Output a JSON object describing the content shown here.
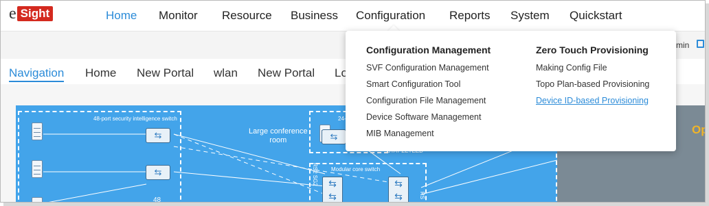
{
  "logo": {
    "prefix": "e",
    "boxed": "Sight"
  },
  "nav": {
    "items": [
      {
        "label": "Home",
        "active": true
      },
      {
        "label": "Monitor"
      },
      {
        "label": "Resource"
      },
      {
        "label": "Business"
      },
      {
        "label": "Configuration"
      },
      {
        "label": "Reports"
      },
      {
        "label": "System"
      },
      {
        "label": "Quickstart"
      }
    ]
  },
  "user": {
    "text": "min"
  },
  "tabs": {
    "items": [
      {
        "label": "Navigation",
        "active": true
      },
      {
        "label": "Home"
      },
      {
        "label": "New Portal"
      },
      {
        "label": "wlan"
      },
      {
        "label": "New Portal"
      },
      {
        "label": "Lo"
      }
    ]
  },
  "dropdown": {
    "col1": {
      "title": "Configuration Management",
      "items": [
        "SVF Configuration Management",
        "Smart Configuration Tool",
        "Configuration File Management",
        "Device Software Management",
        "MIB Management"
      ]
    },
    "col2": {
      "title": "Zero Touch Provisioning",
      "items": [
        "Making Config File",
        "Topo Plan-based Provisioning",
        "Device ID-based Provisioning"
      ]
    }
  },
  "topology": {
    "zone1_label": "48-port security intelligence switch",
    "zone2_label": "24-",
    "zone3_label": "Modular core switch",
    "conference_line1": "Large conference",
    "conference_line2": "room",
    "partial_label": "STAT ZETEED",
    "partial_bottom": "48",
    "rot_label1": "RS2 SG2",
    "rot_label2": "RS"
  },
  "side_panel": {
    "text": "Op"
  },
  "colors": {
    "accent": "#2b8bd8",
    "brand": "#d42a1f",
    "topology_bg": "#43a4ea"
  }
}
